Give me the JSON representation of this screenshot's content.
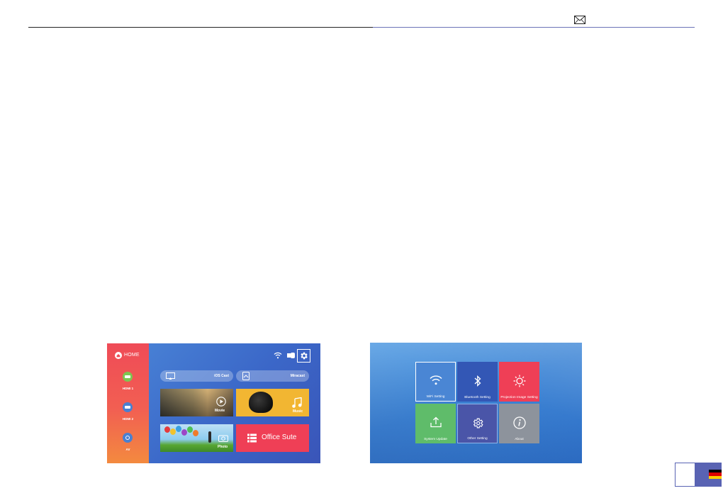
{
  "header": {
    "mail_icon": "mail-icon"
  },
  "home_screen": {
    "sidebar_title": "HOME",
    "sources": [
      {
        "label": "HDMI 1",
        "color": "#7ec552"
      },
      {
        "label": "HDMI 2",
        "color": "#4a80d0"
      },
      {
        "label": "AV",
        "color": "#4a80d0"
      }
    ],
    "pills": [
      {
        "label": "iOS Cast"
      },
      {
        "label": "Miracast"
      }
    ],
    "tiles": [
      {
        "label": "Movie"
      },
      {
        "label": "Music"
      },
      {
        "label": "Photo"
      },
      {
        "label": "Office Sute"
      }
    ],
    "colors": {
      "sidebar": "#ef4b57",
      "main": "#3b67c8",
      "music_tile": "#f2b632",
      "office_tile": "#ef3f56"
    }
  },
  "settings_screen": {
    "tiles": [
      {
        "label": "WiFi Setting",
        "color": "#4a86d4",
        "icon": "wifi-icon",
        "selected": true
      },
      {
        "label": "Bluetooth Setting",
        "color": "#3357b5",
        "icon": "bluetooth-icon",
        "selected": false
      },
      {
        "label": "Projection Image Setting",
        "color": "#ef3f56",
        "icon": "brightness-icon",
        "selected": false
      },
      {
        "label": "System Update",
        "color": "#5fbc6a",
        "icon": "upload-icon",
        "selected": false
      },
      {
        "label": "Other Setting",
        "color": "#4a55a8",
        "icon": "gear-icon",
        "selected": false
      },
      {
        "label": "About",
        "color": "#8d939c",
        "icon": "info-icon",
        "selected": false
      }
    ]
  },
  "language": {
    "flag": "germany-flag",
    "flag_colors": [
      "#000000",
      "#dd0000",
      "#ffce00"
    ]
  }
}
